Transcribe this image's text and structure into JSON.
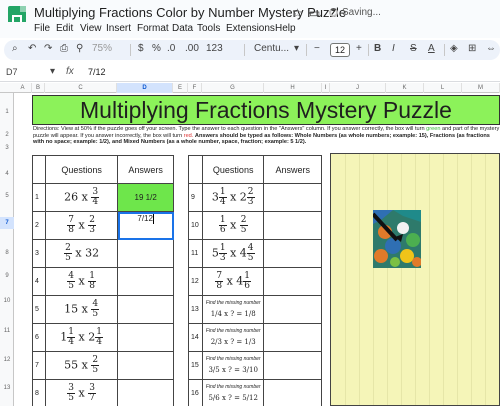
{
  "app": {
    "doc_title": "Multiplying Fractions Color by Number Mystery Puzzle",
    "saving_text": "Saving...",
    "menus": [
      "File",
      "Edit",
      "View",
      "Insert",
      "Format",
      "Data",
      "Tools",
      "Extensions",
      "Help"
    ]
  },
  "toolbar": {
    "zoom": "75%",
    "currency": "$",
    "percent": "%",
    "decimal_down": ".0",
    "decimal_up": ".00",
    "number_format": "123",
    "font": "Centu...",
    "font_size": "12",
    "bold": "B",
    "italic": "I",
    "strike": "S",
    "text_color": "A"
  },
  "formula_bar": {
    "cell_ref": "D7",
    "fx": "fx",
    "value": "7/12"
  },
  "columns": [
    "A",
    "B",
    "C",
    "D",
    "E",
    "F",
    "G",
    "H",
    "I",
    "J",
    "K",
    "L",
    "M"
  ],
  "selected_column": "D",
  "rows": [
    "1",
    "2",
    "3",
    "4",
    "5",
    "6",
    "7",
    "8",
    "9",
    "10",
    "11",
    "12",
    "13"
  ],
  "selected_row": "7",
  "sheet": {
    "title": "Multiplying Fractions Mystery Puzzle",
    "directions_1": "Directions: View at 50% if the puzzle goes off your screen. Type the answer to each question in the \"Answers\" column. If you answer correctly, the box will turn",
    "directions_green": "green",
    "directions_2": "and part of the mystery puzzle will appear. If you answer incorrectly, the box will turn",
    "directions_red": "red.",
    "directions_3": "Answers should be typed as follows: Whole Numbers (as whole numbers; example: 15), Fractions (as fractions with no space; example: 1/2), and Mixed Numbers (as a whole number, space, fraction; example: 5 1/2).",
    "questions_header": "Questions",
    "answers_header": "Answers",
    "left_numbers": [
      "1",
      "2",
      "3",
      "4",
      "5",
      "6",
      "7",
      "8"
    ],
    "right_numbers": [
      "9",
      "10",
      "11",
      "12",
      "13",
      "14",
      "15",
      "16"
    ],
    "answer_1": "19 1/2",
    "answer_2": "7/12",
    "missing_label": "Find the missing number"
  },
  "colors": {
    "title_bg": "#8cf25a",
    "correct_green": "#6ee64b",
    "mystery_bg": "#f5f5b8",
    "selection_blue": "#1a73e8"
  }
}
